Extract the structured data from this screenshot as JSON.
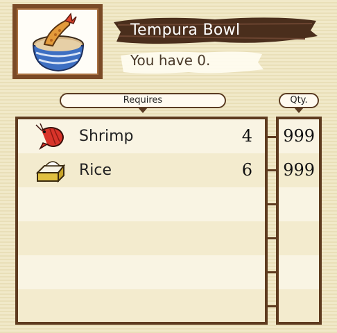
{
  "item": {
    "name": "Tempura Bowl",
    "owned_text": "You have 0.",
    "icon": "tempura-bowl-icon"
  },
  "headers": {
    "requires": "Requires",
    "qty": "Qty."
  },
  "requirements": [
    {
      "name": "Shrimp",
      "icon": "shrimp-icon",
      "required": "4",
      "qty": "999"
    },
    {
      "name": "Rice",
      "icon": "rice-icon",
      "required": "6",
      "qty": "999"
    }
  ],
  "colors": {
    "frame": "#7a4a26",
    "panel_border": "#5e3b1f",
    "title_band": "#4a2e1c"
  }
}
